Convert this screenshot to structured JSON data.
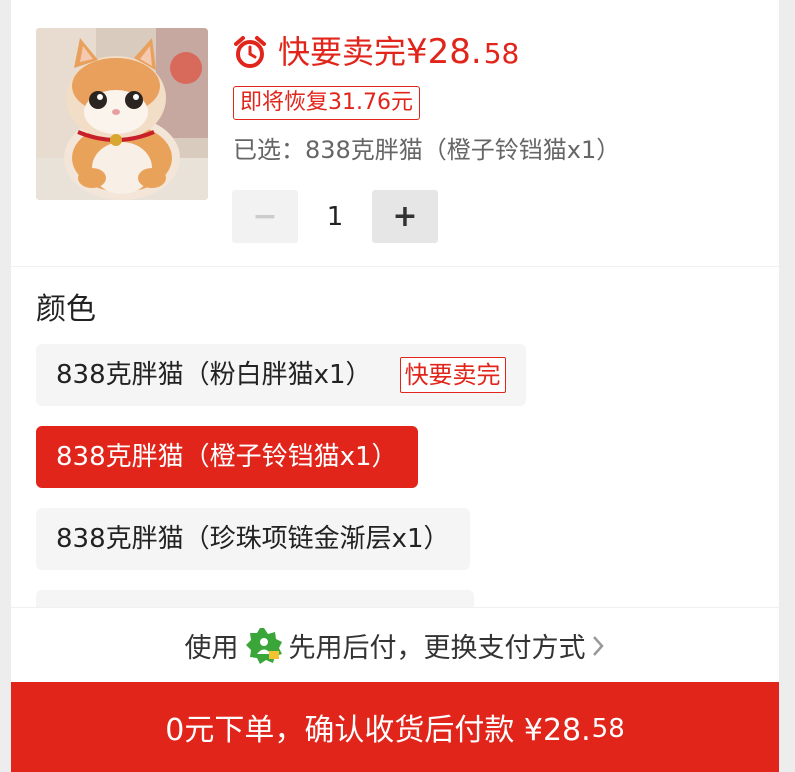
{
  "header": {
    "price_label": "快要卖完",
    "price_integer": "¥28.",
    "price_decimal": "58",
    "restore_badge": "即将恢复31.76元",
    "selected_text": "已选：838克胖猫（橙子铃铛猫x1）"
  },
  "quantity": {
    "minus": "−",
    "value": "1",
    "plus": "+"
  },
  "color_section": {
    "title": "颜色",
    "options": [
      {
        "label": "838克胖猫（粉白胖猫x1）",
        "badge": "快要卖完",
        "selected": false
      },
      {
        "label": "838克胖猫（橙子铃铛猫x1）",
        "selected": true
      },
      {
        "label": "838克胖猫（珍珠项链金渐层x1）",
        "selected": false
      }
    ]
  },
  "payment": {
    "prefix": "使用",
    "method": "先用后付，更换支付方式"
  },
  "cta": {
    "text": "0元下单，确认收货后付款 ¥28.",
    "decimal": "58"
  },
  "colors": {
    "accent": "#e1251b",
    "pay_icon_green": "#3aa63a"
  }
}
